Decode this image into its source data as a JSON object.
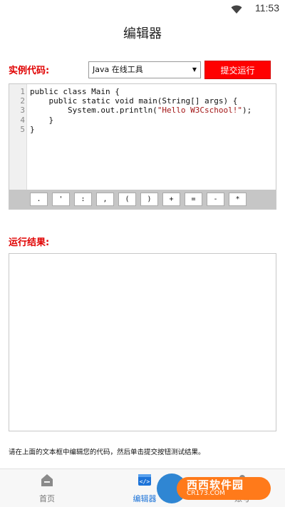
{
  "status_bar": {
    "time": "11:53",
    "wifi_icon": "wifi-icon"
  },
  "header": {
    "title": "编辑器"
  },
  "toolbar": {
    "code_label": "实例代码:",
    "language": "Java 在线工具",
    "run_label": "提交运行"
  },
  "editor": {
    "line_numbers": [
      "1",
      "2",
      "3",
      "4",
      "5"
    ],
    "lines": [
      "public class Main {",
      "    public static void main(String[] args) {",
      "        System.out.println(\"Hello W3Cschool!\");",
      "    }",
      "}"
    ]
  },
  "symbols": [
    ".",
    "'",
    ":",
    ",",
    "(",
    ")",
    "+",
    "=",
    "-",
    "*"
  ],
  "result": {
    "label": "运行结果:"
  },
  "hint": "请在上面的文本框中编辑您的代码，然后单击提交按钮测试结果。",
  "bottom_nav": {
    "home": "首页",
    "editor": "编辑器",
    "account": "账号"
  },
  "watermark": {
    "brand": "西西软件园",
    "site": "CR173.COM"
  },
  "colors": {
    "accent_red": "#ff0000",
    "nav_active": "#1c73d8"
  }
}
